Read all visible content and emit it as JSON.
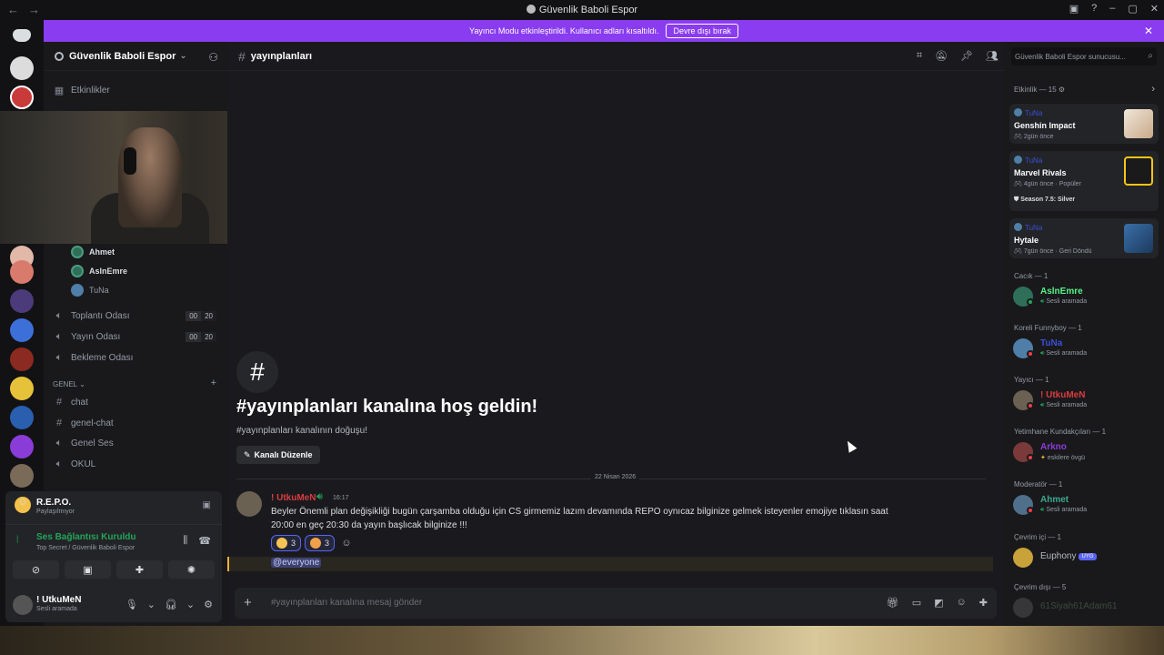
{
  "window": {
    "title": "Güvenlik Baboli Espor",
    "back": "←",
    "forward": "→",
    "controls": [
      "▣",
      "?",
      "–",
      "▢",
      "✕"
    ]
  },
  "banner": {
    "text": "Yayıncı Modu etkinleştirildi. Kullanıcı adları kısaltıldı.",
    "button": "Devre dışı bırak",
    "close": "✕"
  },
  "server": {
    "name": "Güvenlik Baboli Espor",
    "chevron": "⌄"
  },
  "sidebar": {
    "events_label": "Etkinlikler",
    "voice_users": [
      "Ahmet",
      "AslnEmre",
      "TuNa"
    ],
    "voice_channels": [
      {
        "name": "Toplantı Odası",
        "count_a": "00",
        "count_b": "20"
      },
      {
        "name": "Yayın Odası",
        "count_a": "00",
        "count_b": "20"
      },
      {
        "name": "Bekleme Odası"
      }
    ],
    "category": "GENEL",
    "text_channels": [
      "chat",
      "genel-chat"
    ],
    "voice_channel_2": "Genel Ses",
    "text_channel_3": "OKUL"
  },
  "activity_panel": {
    "game": "R.E.P.O.",
    "game_sub": "Paylaşılmıyor",
    "connection": "Ses Bağlantısı Kuruldu",
    "connection_sub": "Top Secret / Güvenlik Baboli Espor"
  },
  "user_panel": {
    "name": "! UtkuMeN",
    "status": "Sesli aramada"
  },
  "chat": {
    "channel": "yayınplanları",
    "welcome_title": "#yayınplanları kanalına hoş geldin!",
    "welcome_sub": "#yayınplanları kanalının doğuşu!",
    "edit_button": "Kanalı Düzenle",
    "date": "22 Nisan 2026",
    "message": {
      "author": "! UtkuMeN",
      "time": "16:17",
      "text": "Beyler Önemli plan değişikliği bugün çarşamba olduğu için CS girmemiz lazım devamında REPO oynıcaz bilginize gelmek isteyenler emojiye tıklasın saat 20:00 en geç 20:30 da yayın başlıcak bilginize !!!",
      "reactions": [
        {
          "count": "3"
        },
        {
          "count": "3"
        }
      ],
      "mention": "@everyone"
    },
    "composer_placeholder": "#yayınplanları kanalına mesaj gönder"
  },
  "members": {
    "search_placeholder": "Güvenlik Baboli Espor sunucusu...",
    "activity_header": "Etkinlik — 15",
    "activities": [
      {
        "by": "TuNa",
        "game": "Genshin Impact",
        "meta": "2gün önce"
      },
      {
        "by": "TuNa",
        "game": "Marvel Rivals",
        "meta": "4gün önce · Popüler",
        "extra": "Season 7.5: Silver"
      },
      {
        "by": "TuNa",
        "game": "Hytale",
        "meta": "7gün önce · Geri Döndü"
      }
    ],
    "groups": [
      {
        "header": "Cacık — 1",
        "name": "AslnEmre",
        "sub": "Sesli aramada",
        "color": "#57f287"
      },
      {
        "header": "Koreli Funnyboy — 1",
        "name": "TuNa",
        "sub": "Sesli aramada",
        "color": "#3b4fd9"
      },
      {
        "header": "Yayıcı — 1",
        "name": "! UtkuMeN",
        "sub": "Sesli aramada",
        "color": "#d83c3e"
      },
      {
        "header": "Yetimhane Kundakçıları — 1",
        "name": "Arkno",
        "sub": "eskilere övgü",
        "color": "#8e3cd8"
      },
      {
        "header": "Moderatör — 1",
        "name": "Ahmet",
        "sub": "Sesli aramada",
        "color": "#3ea88c"
      },
      {
        "header": "Çevrim içi — 1",
        "name": "Euphony",
        "badge": "UYG",
        "color": "#b5bac1"
      },
      {
        "header": "Çevrim dışı — 5",
        "name": "61Siyah61Adam61",
        "color": "#5c7a5c"
      }
    ]
  }
}
